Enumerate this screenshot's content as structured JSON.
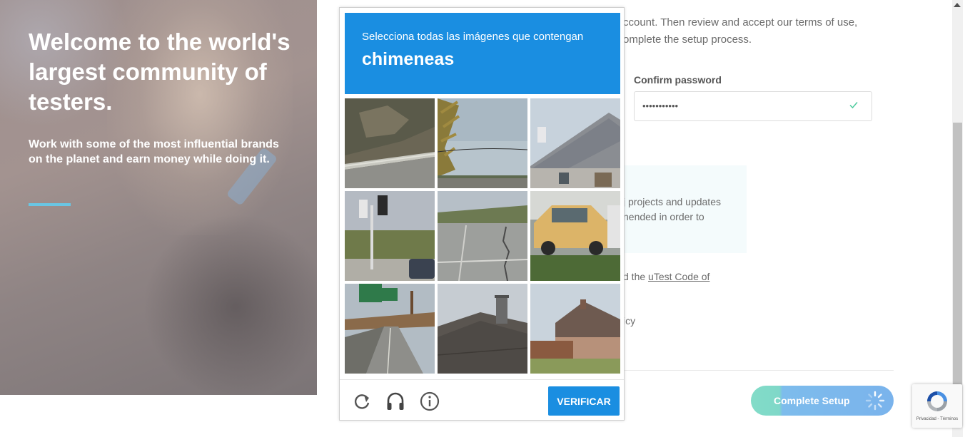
{
  "hero": {
    "title": "Welcome to the world's largest community of testers.",
    "subtitle": "Work with some of the most influential brands on the planet and earn money while doing it."
  },
  "form": {
    "intro_line1": "ccount. Then review and accept our terms of use,",
    "intro_line2": "omplete the setup process.",
    "confirm_password_label": "Confirm password",
    "confirm_password_value": "•••••••••••",
    "info_line1": "j projects and updates",
    "info_line2": "nended in order to",
    "agree_prefix": "d the ",
    "agree_link": "uTest Code of",
    "policy_fragment": "icy",
    "complete_button": "Complete Setup"
  },
  "captcha": {
    "instruction": "Selecciona todas las imágenes que contengan",
    "target": "chimeneas",
    "verify_button": "VERIFICAR",
    "tiles": [
      {
        "name": "tile-hillside-road"
      },
      {
        "name": "tile-palm-sky"
      },
      {
        "name": "tile-house-roof-chimney"
      },
      {
        "name": "tile-traffic-light"
      },
      {
        "name": "tile-road-crack"
      },
      {
        "name": "tile-taxi"
      },
      {
        "name": "tile-highway-sign"
      },
      {
        "name": "tile-roof-chimney"
      },
      {
        "name": "tile-brick-house"
      }
    ]
  },
  "recaptcha_badge": {
    "links": "Privacidad - Términos"
  },
  "colors": {
    "captcha_blue": "#1a8ee1",
    "hero_accent": "#69c6e4",
    "check_green": "#4ecb9e"
  }
}
